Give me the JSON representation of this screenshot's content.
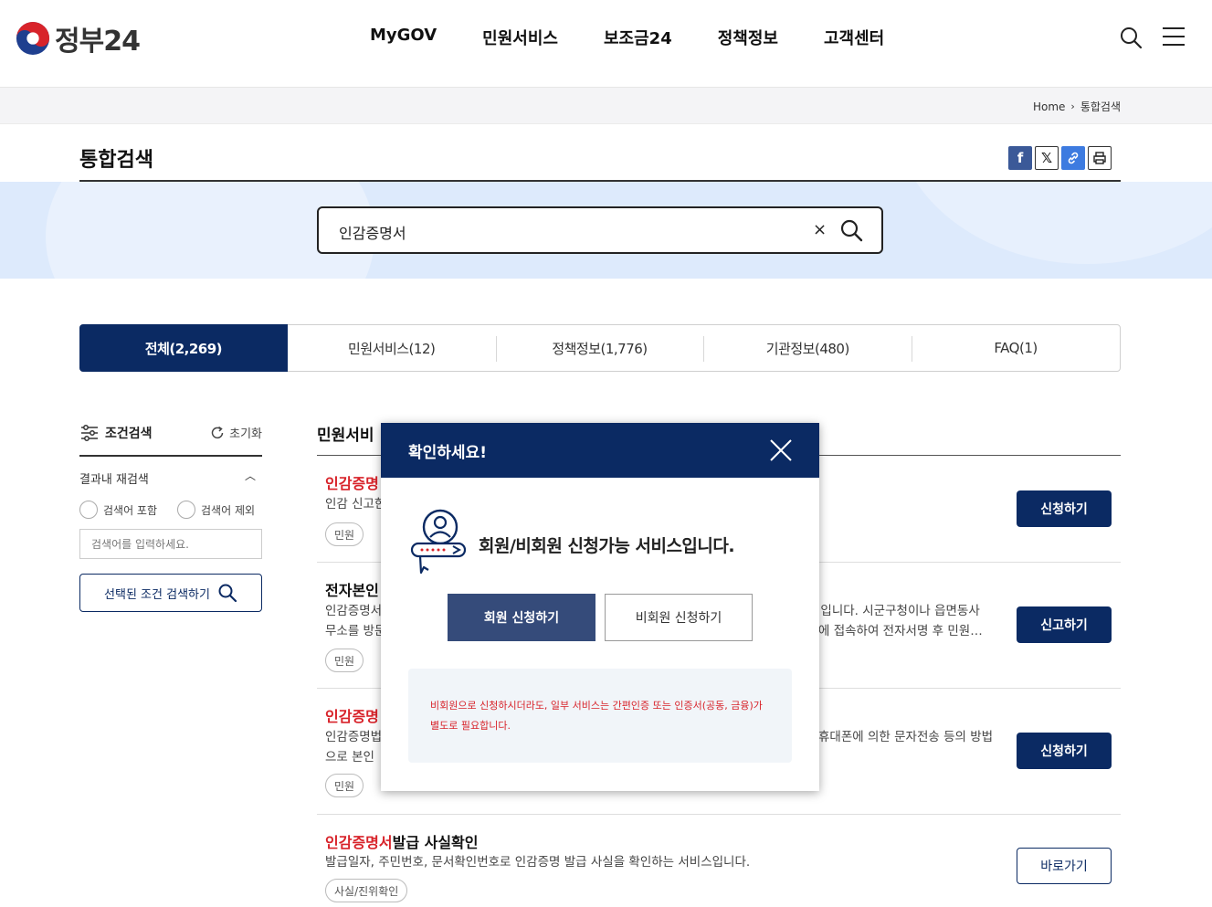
{
  "header": {
    "logo_text": "정부24",
    "nav": [
      "MyGOV",
      "민원서비스",
      "보조금24",
      "정책정보",
      "고객센터"
    ],
    "search_icon": "search-icon",
    "menu_icon": "hamburger-menu-icon"
  },
  "breadcrumb": {
    "home": "Home",
    "current": "통합검색"
  },
  "page": {
    "title": "통합검색"
  },
  "share": {
    "icons": [
      "facebook-icon",
      "x-icon",
      "link-icon",
      "print-icon"
    ]
  },
  "search": {
    "value": "인감증명서",
    "clear": "×"
  },
  "tabs": [
    {
      "label": "전체(2,269)",
      "active": true
    },
    {
      "label": "민원서비스(12)",
      "active": false
    },
    {
      "label": "정책정보(1,776)",
      "active": false
    },
    {
      "label": "기관정보(480)",
      "active": false
    },
    {
      "label": "FAQ(1)",
      "active": false
    }
  ],
  "filter": {
    "title": "조건검색",
    "reset": "초기화",
    "refine_label": "결과내 재검색",
    "include": "검색어 포함",
    "exclude": "검색어 제외",
    "placeholder": "검색어를 입력하세요.",
    "submit": "선택된 조건 검색하기"
  },
  "results": {
    "section_title": "민원서비",
    "items": [
      {
        "hl": "인감증명",
        "rest": "",
        "desc": "인감 신고한",
        "tag": "민원",
        "button": "신청하기",
        "outline": false
      },
      {
        "hl": "",
        "rest": "전자본인",
        "desc": "인감증명서",
        "desc_right": "원입니다. 시군구청이나 읍면동사",
        "desc2": "무소를 방문",
        "desc2_right": "에 접속하여 전자서명 후 민원…",
        "tag": "민원",
        "button": "신고하기",
        "outline": false
      },
      {
        "hl": "인감증명",
        "rest": "",
        "desc": "인감증명법",
        "desc_right": "휴대폰에 의한 문자전송 등의 방법",
        "desc2": "으로 본인",
        "tag": "민원",
        "button": "신청하기",
        "outline": false
      },
      {
        "hl": "인감증명서",
        "rest": "발급 사실확인",
        "desc": "발급일자, 주민번호, 문서확인번호로 인감증명 발급 사실을 확인하는 서비스입니다.",
        "tag": "사실/진위확인",
        "button": "바로가기",
        "outline": true
      }
    ]
  },
  "modal": {
    "title": "확인하세요!",
    "message": "회원/비회원 신청가능 서비스입니다.",
    "member_button": "회원 신청하기",
    "guest_button": "비회원 신청하기",
    "note_line1": "비회원으로 신청하시더라도, 일부 서비스는 간편인증 또는 인증서(공동, 금융)가",
    "note_line2": "별도로 필요합니다."
  },
  "colors": {
    "navy": "#0b2a63",
    "highlight": "#d8232a",
    "band": "#ddeafc"
  }
}
